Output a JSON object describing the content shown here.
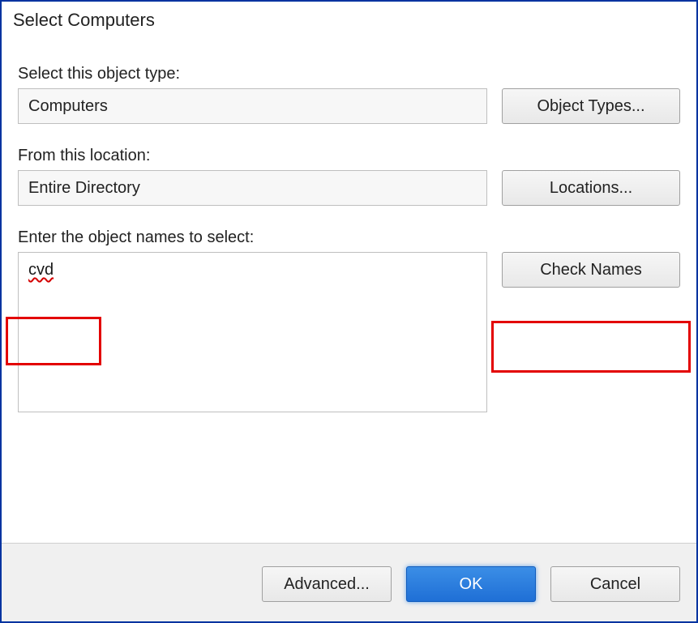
{
  "dialog": {
    "title": "Select Computers",
    "object_type": {
      "label": "Select this object type:",
      "value": "Computers",
      "button": "Object Types..."
    },
    "location": {
      "label": "From this location:",
      "value": "Entire Directory",
      "button": "Locations..."
    },
    "object_names": {
      "label": "Enter the object names to select:",
      "value": "cvd",
      "check_button": "Check Names"
    },
    "footer": {
      "advanced": "Advanced...",
      "ok": "OK",
      "cancel": "Cancel"
    }
  }
}
